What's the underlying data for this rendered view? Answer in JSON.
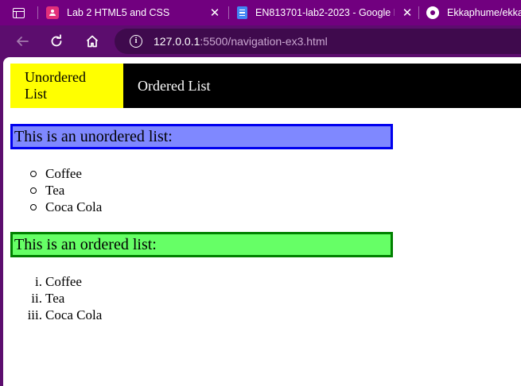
{
  "browser": {
    "tabs": [
      {
        "title": "Lab 2 HTML5 and CSS",
        "favicon": "classroom-person-icon"
      },
      {
        "title": "EN813701-lab2-2023 - Google D",
        "favicon": "google-docs-icon"
      },
      {
        "title": "Ekkaphume/ekkap",
        "favicon": "github-icon"
      }
    ],
    "address": {
      "host": "127.0.0.1",
      "rest": ":5500/navigation-ex3.html"
    }
  },
  "page": {
    "nav": [
      {
        "label": "Unordered List",
        "state": "active",
        "color": "#ffff00"
      },
      {
        "label": "Ordered List",
        "state": "inactive"
      }
    ],
    "unordered_heading": "This is an unordered list:",
    "unordered_items": [
      "Coffee",
      "Tea",
      "Coca Cola"
    ],
    "ordered_heading": "This is an ordered list:",
    "ordered_items": [
      {
        "marker": "i.",
        "text": "Coffee"
      },
      {
        "marker": "ii.",
        "text": "Tea"
      },
      {
        "marker": "iii.",
        "text": "Coca Cola"
      }
    ]
  },
  "colors": {
    "tabstrip": "#71007f",
    "toolbar": "#5c0d6e",
    "unordered_heading_bg": "#7f88ff",
    "unordered_heading_border": "#0000ee",
    "ordered_heading_bg": "#66ff66",
    "ordered_heading_border": "#008000"
  }
}
